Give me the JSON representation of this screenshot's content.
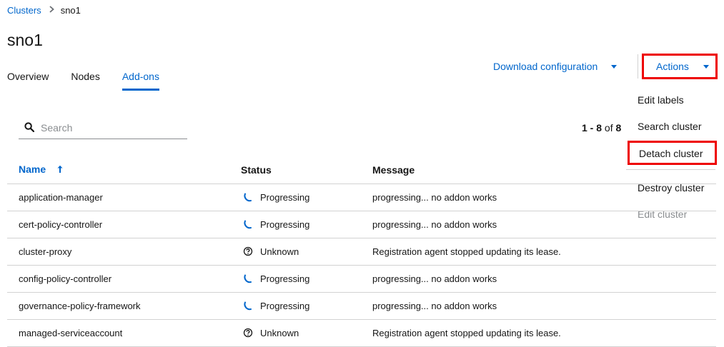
{
  "breadcrumb": {
    "parent": "Clusters",
    "current": "sno1"
  },
  "page_title": "sno1",
  "tabs": [
    {
      "label": "Overview",
      "active": false
    },
    {
      "label": "Nodes",
      "active": false
    },
    {
      "label": "Add-ons",
      "active": true
    }
  ],
  "toolbar": {
    "download_label": "Download configuration",
    "actions_label": "Actions"
  },
  "actions_menu": [
    {
      "label": "Edit labels",
      "highlight": false,
      "disabled": false
    },
    {
      "label": "Search cluster",
      "highlight": false,
      "disabled": false
    },
    {
      "label": "Detach cluster",
      "highlight": true,
      "disabled": false
    },
    {
      "label": "Destroy cluster",
      "highlight": false,
      "disabled": false
    },
    {
      "label": "Edit cluster",
      "highlight": false,
      "disabled": true
    }
  ],
  "search": {
    "placeholder": "Search",
    "value": ""
  },
  "pagination": {
    "range": "1 - 8",
    "of_label": "of",
    "total": "8"
  },
  "table": {
    "columns": {
      "name": "Name",
      "status": "Status",
      "message": "Message"
    },
    "rows": [
      {
        "name": "application-manager",
        "status": "Progressing",
        "icon": "progress-icon",
        "message": "progressing... no addon works"
      },
      {
        "name": "cert-policy-controller",
        "status": "Progressing",
        "icon": "progress-icon",
        "message": "progressing... no addon works"
      },
      {
        "name": "cluster-proxy",
        "status": "Unknown",
        "icon": "unknown-icon",
        "message": "Registration agent stopped updating its lease."
      },
      {
        "name": "config-policy-controller",
        "status": "Progressing",
        "icon": "progress-icon",
        "message": "progressing... no addon works"
      },
      {
        "name": "governance-policy-framework",
        "status": "Progressing",
        "icon": "progress-icon",
        "message": "progressing... no addon works"
      },
      {
        "name": "managed-serviceaccount",
        "status": "Unknown",
        "icon": "unknown-icon",
        "message": "Registration agent stopped updating its lease."
      }
    ]
  },
  "colors": {
    "link": "#0066cc",
    "highlight": "#ee0000",
    "border": "#d2d2d2",
    "disabled": "#8a8d90"
  }
}
